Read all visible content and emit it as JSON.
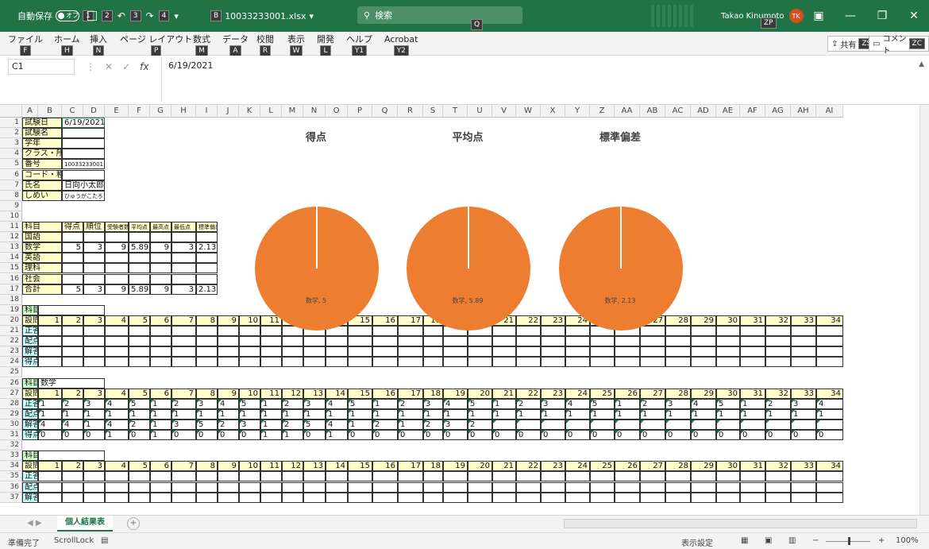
{
  "titlebar": {
    "autosave_label": "自動保存",
    "autosave_state": "オフ",
    "keytips": [
      "1",
      "2",
      "3",
      "4"
    ],
    "file_keytip": "B",
    "filename": "10033233001.xlsx",
    "search_placeholder": "検索",
    "search_keytip": "Q",
    "user_name": "Takao Kinumoto",
    "user_keytip": "ZP",
    "user_initials": "TK"
  },
  "ribbon": {
    "tabs": [
      {
        "label": "ファイル",
        "key": "F"
      },
      {
        "label": "ホーム",
        "key": "H"
      },
      {
        "label": "挿入",
        "key": "N"
      },
      {
        "label": "ページ レイアウト",
        "key": "P"
      },
      {
        "label": "数式",
        "key": "M"
      },
      {
        "label": "データ",
        "key": "A"
      },
      {
        "label": "校閲",
        "key": "R"
      },
      {
        "label": "表示",
        "key": "W"
      },
      {
        "label": "開発",
        "key": "L"
      },
      {
        "label": "ヘルプ",
        "key": "Y1"
      },
      {
        "label": "Acrobat",
        "key": "Y2"
      }
    ],
    "share_label": "共有",
    "share_key": "ZS",
    "comment_label": "コメント",
    "comment_key": "ZC"
  },
  "formula": {
    "name_box": "C1",
    "fx": "fx",
    "value": "6/19/2021"
  },
  "columns": [
    "A",
    "B",
    "C",
    "D",
    "E",
    "F",
    "G",
    "H",
    "I",
    "J",
    "K",
    "L",
    "M",
    "N",
    "O",
    "P",
    "Q",
    "R",
    "S",
    "T",
    "U",
    "V",
    "W",
    "X",
    "Y",
    "Z",
    "AA",
    "AB",
    "AC",
    "AD",
    "AE",
    "AF",
    "AG",
    "AH",
    "AI"
  ],
  "rows": [
    "1",
    "2",
    "3",
    "4",
    "5",
    "6",
    "7",
    "8",
    "9",
    "10",
    "11",
    "12",
    "13",
    "14",
    "15",
    "16",
    "17",
    "18",
    "19",
    "20",
    "21",
    "22",
    "23",
    "24",
    "25",
    "26",
    "27",
    "28",
    "29",
    "30",
    "31",
    "32",
    "33",
    "34",
    "35",
    "36",
    "37"
  ],
  "info_block": {
    "labels": [
      "試験日",
      "試験名",
      "学年",
      "クラス・所属",
      "番号",
      "コード・種別",
      "氏名",
      "しめい"
    ],
    "values": [
      "6/19/2021",
      "",
      "",
      "",
      "10033233001",
      "",
      "日向小太郎",
      "ひゅうがこたろう"
    ]
  },
  "score_table": {
    "headers": [
      "科目",
      "得点",
      "順位",
      "受験者数",
      "平均点",
      "最高点",
      "最低点",
      "標準偏差"
    ],
    "rows": [
      [
        "国語",
        "",
        "",
        "",
        "",
        "",
        "",
        ""
      ],
      [
        "数学",
        "5",
        "3",
        "9",
        "5.89",
        "9",
        "3",
        "2.13"
      ],
      [
        "英語",
        "",
        "",
        "",
        "",
        "",
        "",
        ""
      ],
      [
        "理科",
        "",
        "",
        "",
        "",
        "",
        "",
        ""
      ],
      [
        "社会",
        "",
        "",
        "",
        "",
        "",
        "",
        ""
      ],
      [
        "合計",
        "5",
        "3",
        "9",
        "5.89",
        "9",
        "3",
        "2.13"
      ]
    ]
  },
  "question_block_labels": {
    "subject": "科目",
    "question": "設問",
    "correct": "正答",
    "points": "配点",
    "answer": "解答",
    "score": "得点"
  },
  "subject_2": "数学",
  "question_numbers": [
    "1",
    "2",
    "3",
    "4",
    "5",
    "6",
    "7",
    "8",
    "9",
    "10",
    "11",
    "12",
    "13",
    "14",
    "15",
    "16",
    "17",
    "18",
    "19",
    "20",
    "21",
    "22",
    "23",
    "24",
    "25",
    "26",
    "27",
    "28",
    "29",
    "30",
    "31",
    "32",
    "33",
    "34"
  ],
  "math_rows": {
    "correct": [
      "1",
      "2",
      "3",
      "4",
      "5",
      "1",
      "2",
      "3",
      "4",
      "5",
      "1",
      "2",
      "3",
      "4",
      "5",
      "1",
      "2",
      "3",
      "4",
      "5",
      "1",
      "2",
      "3",
      "4",
      "5",
      "1",
      "2",
      "3",
      "4",
      "5",
      "1",
      "2",
      "3",
      "4"
    ],
    "points": [
      "1",
      "1",
      "1",
      "1",
      "1",
      "1",
      "1",
      "1",
      "1",
      "1",
      "1",
      "1",
      "1",
      "1",
      "1",
      "1",
      "1",
      "1",
      "1",
      "1",
      "1",
      "1",
      "1",
      "1",
      "1",
      "1",
      "1",
      "1",
      "1",
      "1",
      "1",
      "1",
      "1",
      "1"
    ],
    "answer": [
      "4",
      "4",
      "1",
      "4",
      "2",
      "1",
      "3",
      "5",
      "2",
      "3",
      "1",
      "2",
      "5",
      "4",
      "1",
      "2",
      "1",
      "2",
      "3",
      "2",
      "",
      "",
      "",
      "",
      "",
      "",
      "",
      "",
      "",
      "",
      "",
      "",
      "",
      ""
    ],
    "score": [
      "0",
      "0",
      "0",
      "1",
      "0",
      "1",
      "0",
      "0",
      "0",
      "0",
      "1",
      "1",
      "0",
      "1",
      "0",
      "0",
      "0",
      "0",
      "0",
      "0",
      "0",
      "0",
      "0",
      "0",
      "0",
      "0",
      "0",
      "0",
      "0",
      "0",
      "0",
      "0",
      "0",
      "0"
    ]
  },
  "charts": [
    {
      "title": "得点",
      "label": "数学, 5"
    },
    {
      "title": "平均点",
      "label": "数学, 5.89"
    },
    {
      "title": "標準偏差",
      "label": "数学, 2.13"
    }
  ],
  "chart_color": "#ed7d31",
  "sheet": {
    "tab_name": "個人結果表",
    "add": "+"
  },
  "status": {
    "ready": "準備完了",
    "scroll_lock": "ScrollLock",
    "display_settings": "表示設定",
    "zoom": "100%"
  }
}
